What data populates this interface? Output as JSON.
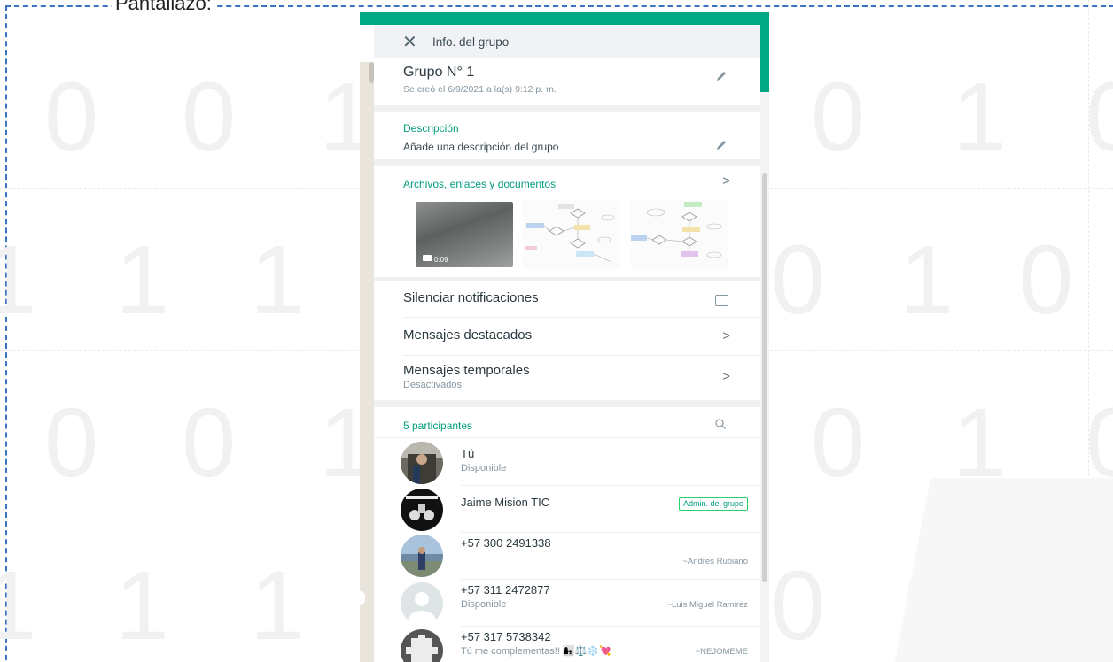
{
  "frame": {
    "caption": "Pantallazo:"
  },
  "background_digits": [
    "0",
    "0",
    "1",
    "0",
    "1",
    "0",
    "1",
    "1",
    "1",
    "0",
    "1",
    "0",
    "0",
    "0",
    "1",
    "0",
    "1",
    "0",
    "1",
    "1",
    "1",
    "0",
    "1"
  ],
  "colors": {
    "accent": "#00a884",
    "section": "#029e7c",
    "text": "#2b3940",
    "muted": "#8696a0",
    "panel_bg": "#eef0f1"
  },
  "header": {
    "close_icon": "close-icon",
    "title": "Info. del grupo"
  },
  "group": {
    "name": "Grupo N° 1",
    "created": "Se creó el 6/9/2021 a la(s) 9:12 p. m."
  },
  "description": {
    "title": "Descripción",
    "text": "Añade una descripción del grupo"
  },
  "media": {
    "title": "Archivos, enlaces y documentos",
    "video_duration": "0:09"
  },
  "settings": {
    "mute_label": "Silenciar notificaciones",
    "starred_label": "Mensajes destacados",
    "temporal_label": "Mensajes temporales",
    "temporal_status": "Desactivados"
  },
  "participants": {
    "title": "5 participantes",
    "items": [
      {
        "name": "Tú",
        "status": "Disponible",
        "alias": "",
        "badge": ""
      },
      {
        "name": "Jaime Mision TIC",
        "status": "",
        "alias": "",
        "badge": "Admin. del grupo"
      },
      {
        "name": "+57 300 2491338",
        "status": "",
        "alias": "~Andres Rubiano",
        "badge": ""
      },
      {
        "name": "+57 311 2472877",
        "status": "Disponible",
        "alias": "~Luis Miguel Ramirez",
        "badge": ""
      },
      {
        "name": "+57 317 5738342",
        "status": "Tú me complementas!! 👩‍👧⚖️❄️💘",
        "alias": "~NEJOMEME",
        "badge": ""
      }
    ]
  }
}
